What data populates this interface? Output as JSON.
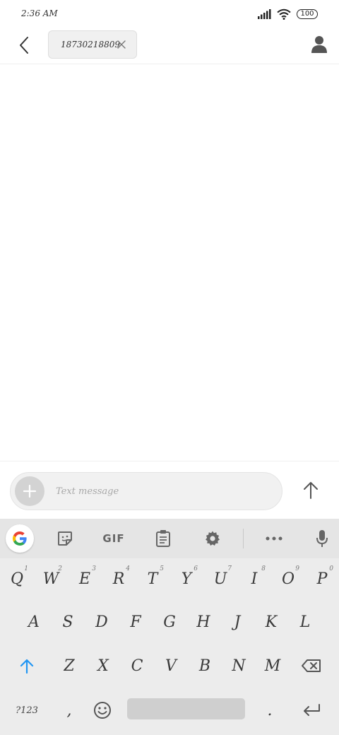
{
  "status_bar": {
    "time": "2:36 AM",
    "battery": "100"
  },
  "header": {
    "recipient": "18730218809",
    "back_icon": "chevron-left-icon",
    "close_icon": "close-icon",
    "contact_icon": "person-icon"
  },
  "compose": {
    "placeholder": "Text message",
    "value": ""
  },
  "keyboard": {
    "toolbar": {
      "gif_label": "GIF"
    },
    "row1": [
      {
        "label": "Q",
        "hint": "1"
      },
      {
        "label": "W",
        "hint": "2"
      },
      {
        "label": "E",
        "hint": "3"
      },
      {
        "label": "R",
        "hint": "4"
      },
      {
        "label": "T",
        "hint": "5"
      },
      {
        "label": "Y",
        "hint": "6"
      },
      {
        "label": "U",
        "hint": "7"
      },
      {
        "label": "I",
        "hint": "8"
      },
      {
        "label": "O",
        "hint": "9"
      },
      {
        "label": "P",
        "hint": "0"
      }
    ],
    "row2": [
      "A",
      "S",
      "D",
      "F",
      "G",
      "H",
      "J",
      "K",
      "L"
    ],
    "row3": [
      "Z",
      "X",
      "C",
      "V",
      "B",
      "N",
      "M"
    ],
    "symbols_label": "?123",
    "comma": ",",
    "period": "."
  },
  "colors": {
    "shift_accent": "#2196f3",
    "keyboard_bg": "#ececec",
    "toolbar_bg": "#e5e5e5"
  }
}
